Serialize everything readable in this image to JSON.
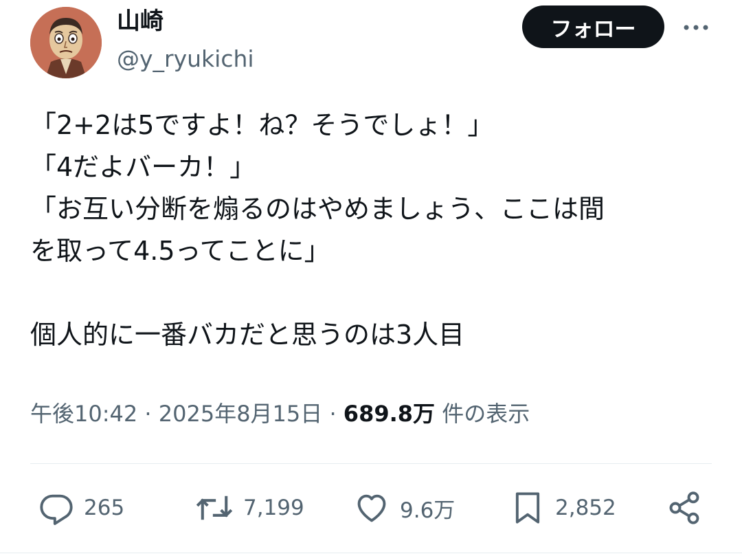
{
  "user": {
    "display_name": "山崎",
    "handle": "@y_ryukichi",
    "avatar_icon": "cartoon-face-avatar"
  },
  "follow_label": "フォロー",
  "more_icon": "more-icon",
  "tweet": {
    "text": "「2+2は5ですよ！ね？そうでしょ！」\n「4だよバーカ！」\n「お互い分断を煽るのはやめましょう、ここは間\nを取って4.5ってことに」\n\n個人的に一番バカだと思うのは3人目"
  },
  "meta": {
    "time": "午後10:42",
    "separator": "·",
    "date": "2025年8月15日",
    "views_count": "689.8万",
    "views_label": "件の表示"
  },
  "actions": {
    "reply": {
      "icon": "reply-icon",
      "count": "265"
    },
    "retweet": {
      "icon": "retweet-icon",
      "count": "7,199"
    },
    "like": {
      "icon": "heart-icon",
      "count": "9.6万"
    },
    "bookmark": {
      "icon": "bookmark-icon",
      "count": "2,852"
    },
    "share": {
      "icon": "share-icon"
    }
  },
  "colors": {
    "text": "#0f1419",
    "secondary": "#536471",
    "follow_bg": "#0f1419"
  }
}
